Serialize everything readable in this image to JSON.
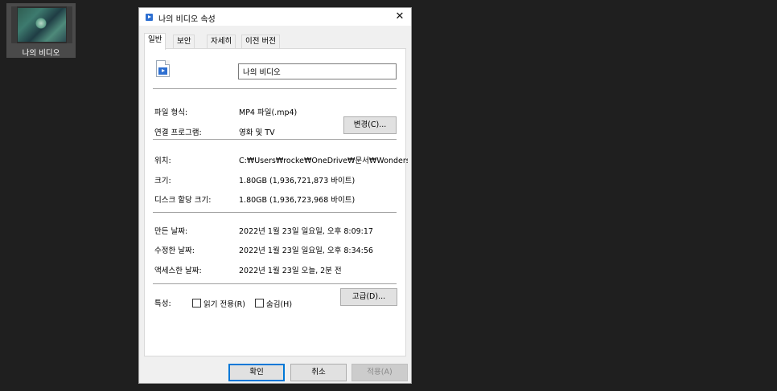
{
  "desktop": {
    "icon_label": "나의 비디오",
    "icon": "video-thumbnail-icon"
  },
  "dialog": {
    "title": "나의 비디오 속성",
    "title_icon": "video-file-icon",
    "close_glyph": "✕",
    "tabs": [
      "일반",
      "보안",
      "자세히",
      "이전 버전"
    ],
    "active_tab": "일반",
    "file_name": "나의 비디오",
    "file_icon": "video-file-icon",
    "rows": {
      "type_label": "파일 형식:",
      "type_value": "MP4 파일(.mp4)",
      "opens_label": "연결 프로그램:",
      "opens_value": "영화 및 TV",
      "change_button": "변경(C)...",
      "location_label": "위치:",
      "location_value": "C:₩Users₩rocke₩OneDrive₩문서₩Wondersh",
      "size_label": "크기:",
      "size_value": "1.80GB (1,936,721,873 바이트)",
      "disk_label": "디스크 할당 크기:",
      "disk_value": "1.80GB (1,936,723,968 바이트)",
      "created_label": "만든 날짜:",
      "created_value": "2022년 1월 23일 일요일, 오후 8:09:17",
      "modified_label": "수정한 날짜:",
      "modified_value": "2022년 1월 23일 일요일, 오후 8:34:56",
      "accessed_label": "액세스한 날짜:",
      "accessed_value": "2022년 1월 23일 오늘, 2분 전",
      "attrs_label": "특성:",
      "readonly_label": "읽기 전용(R)",
      "readonly_checked": false,
      "hidden_label": "숨김(H)",
      "hidden_checked": false,
      "advanced_button": "고급(D)..."
    },
    "buttons": {
      "ok": "확인",
      "cancel": "취소",
      "apply": "적용(A)"
    }
  },
  "colors": {
    "desktop_bg": "#1f1f1f",
    "dialog_bg": "#f0f0f0",
    "accent": "#0078d7"
  }
}
